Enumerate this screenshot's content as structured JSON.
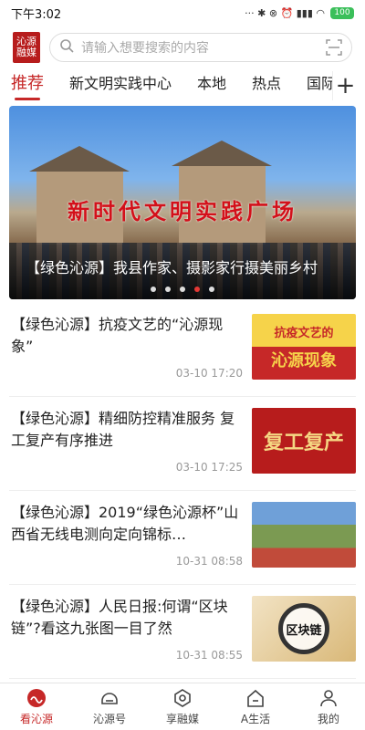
{
  "status_bar": {
    "time": "下午3:02",
    "indicators": "··· ✱ ⊗ ⏰ ▮▮▮ ◠",
    "battery": "100"
  },
  "header": {
    "logo_text": "沁源\n融媒",
    "search_placeholder": "请输入想要搜索的内容"
  },
  "tabs": [
    {
      "label": "推荐",
      "active": true
    },
    {
      "label": "新文明实践中心",
      "active": false
    },
    {
      "label": "本地",
      "active": false
    },
    {
      "label": "热点",
      "active": false
    },
    {
      "label": "国际",
      "active": false
    }
  ],
  "banner": {
    "sign_text": "新时代文明实践广场",
    "caption": "【绿色沁源】我县作家、摄影家行摄美丽乡村",
    "dots_total": 5,
    "dot_active_index": 3
  },
  "news": [
    {
      "title": "【绿色沁源】抗疫文艺的“沁源现象”",
      "time": "03-10 17:20",
      "thumb_top": "抗疫文艺的",
      "thumb_bottom": "沁源现象"
    },
    {
      "title": "【绿色沁源】精细防控精准服务 复工复产有序推进",
      "time": "03-10 17:25",
      "thumb_top": "",
      "thumb_bottom": "复工复产"
    },
    {
      "title": "【绿色沁源】2019“绿色沁源杯”山西省无线电测向定向锦标…",
      "time": "10-31 08:58",
      "thumb_top": "",
      "thumb_bottom": ""
    },
    {
      "title": "【绿色沁源】人民日报:何谓“区块链”?看这九张图一目了然",
      "time": "10-31 08:55",
      "thumb_top": "",
      "thumb_bottom": "区块链"
    }
  ],
  "bottom_nav": [
    {
      "label": "看沁源",
      "active": true
    },
    {
      "label": "沁源号",
      "active": false
    },
    {
      "label": "享融媒",
      "active": false
    },
    {
      "label": "A生活",
      "active": false
    },
    {
      "label": "我的",
      "active": false
    }
  ],
  "colors": {
    "accent": "#c62828",
    "battery": "#3bbf5a"
  }
}
